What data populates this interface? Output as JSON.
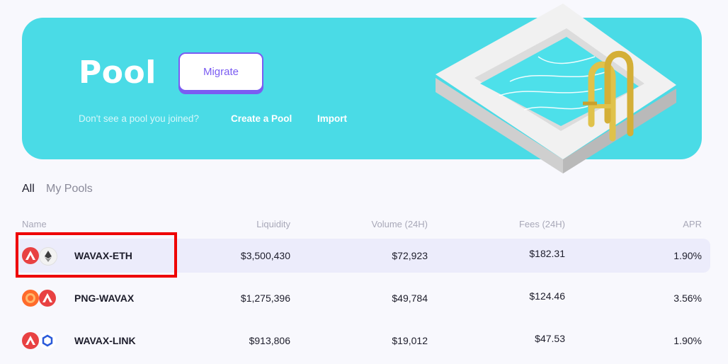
{
  "hero": {
    "title": "Pool",
    "migrate_label": "Migrate",
    "question": "Don't see a pool you joined?",
    "create_label": "Create a Pool",
    "import_label": "Import"
  },
  "tabs": [
    {
      "label": "All",
      "active": true
    },
    {
      "label": "My Pools",
      "active": false
    }
  ],
  "table": {
    "headers": {
      "name": "Name",
      "liquidity": "Liquidity",
      "volume": "Volume (24H)",
      "fees": "Fees (24H)",
      "apr": "APR"
    },
    "rows": [
      {
        "pair": "WAVAX-ETH",
        "liquidity": "$3,500,430",
        "volume": "$72,923",
        "fees": "$182.31",
        "apr": "1.90%",
        "tokens": [
          "avax-icon",
          "eth-icon"
        ],
        "selected": true
      },
      {
        "pair": "PNG-WAVAX",
        "liquidity": "$1,275,396",
        "volume": "$49,784",
        "fees": "$124.46",
        "apr": "3.56%",
        "tokens": [
          "png-icon",
          "avax-icon"
        ],
        "selected": false
      },
      {
        "pair": "WAVAX-LINK",
        "liquidity": "$913,806",
        "volume": "$19,012",
        "fees": "$47.53",
        "apr": "1.90%",
        "tokens": [
          "avax-icon",
          "link-icon"
        ],
        "selected": false
      }
    ]
  },
  "colors": {
    "hero_bg": "#4adbe6",
    "accent": "#7b5cf2",
    "avax": "#e84142",
    "png": "#ff6b2b",
    "link": "#2a5ada",
    "highlight": "#ee0000"
  }
}
